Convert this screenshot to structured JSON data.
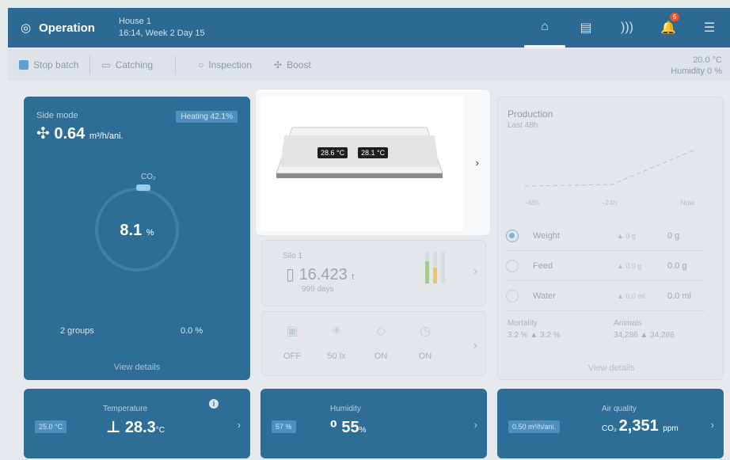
{
  "topbar": {
    "title": "Operation",
    "house_name": "House 1",
    "house_time": "16:14, Week 2 Day 15",
    "notification_count": "5"
  },
  "toolbar": {
    "stop_batch": "Stop batch",
    "catching": "Catching",
    "inspection": "Inspection",
    "boost": "Boost",
    "temperature": "20.0 °C",
    "humidity": "Humidity 0 %"
  },
  "side_mode": {
    "label": "Side mode",
    "value": "0.64",
    "unit": "m³/h/ani.",
    "heating": "Heating 42.1%",
    "co2_label": "CO₂",
    "ring_value": "8.1",
    "ring_unit": "%",
    "groups": "2 groups",
    "percent": "0.0 %",
    "details": "View details"
  },
  "popup": {
    "temp_left": "28.6 °C",
    "temp_right": "28.1 °C"
  },
  "silo": {
    "label": "Silo 1",
    "value": "16.423",
    "unit": "t",
    "days": "999 days"
  },
  "sensors": [
    {
      "state": "OFF"
    },
    {
      "state": "50 lx"
    },
    {
      "state": "ON"
    },
    {
      "state": "ON"
    }
  ],
  "production": {
    "title": "Production",
    "subtitle": "Last 48h",
    "axis": [
      "-48h",
      "-24h",
      "Now"
    ],
    "rows": [
      {
        "name": "Weight",
        "delta": "▲ 0 g",
        "value": "0 g"
      },
      {
        "name": "Feed",
        "delta": "▲ 0.0 g",
        "value": "0.0 g"
      },
      {
        "name": "Water",
        "delta": "▲ 0.0 ml",
        "value": "0.0 ml"
      }
    ],
    "mortality_label": "Mortality",
    "mortality_value": "3.2 %",
    "mortality_delta": "▲ 3.2 %",
    "animals_label": "Animals",
    "animals_value": "34,286",
    "animals_delta": "▲ 34,286",
    "details": "View details"
  },
  "temperature": {
    "label": "Temperature",
    "tag": "25.0 °C",
    "value": "28.3",
    "unit": "°C"
  },
  "humidity": {
    "label": "Humidity",
    "tag": "57 %",
    "value": "55",
    "unit": "%"
  },
  "air_quality": {
    "label": "Air quality",
    "tag": "0.50 m³/h/ani.",
    "value": "2,351",
    "unit": "ppm"
  }
}
